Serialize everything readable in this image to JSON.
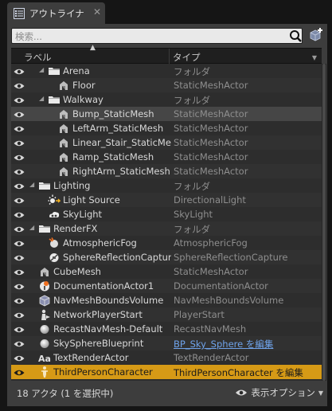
{
  "tab": {
    "title": "アウトライナ"
  },
  "search": {
    "placeholder": "検索..."
  },
  "columns": {
    "label": "ラベル",
    "type": "タイプ"
  },
  "rows": [
    {
      "depth": 3,
      "expanded": true,
      "icon": "folder-icon",
      "label": "Arena",
      "type": "フォルダ"
    },
    {
      "depth": 4,
      "icon": "static-mesh-icon",
      "label": "Floor",
      "type": "StaticMeshActor"
    },
    {
      "depth": 3,
      "expanded": true,
      "icon": "folder-icon",
      "label": "Walkway",
      "type": "フォルダ"
    },
    {
      "depth": 4,
      "icon": "static-mesh-icon",
      "label": "Bump_StaticMesh",
      "type": "StaticMeshActor",
      "highlight": true
    },
    {
      "depth": 4,
      "icon": "static-mesh-icon",
      "label": "LeftArm_StaticMesh",
      "type": "StaticMeshActor"
    },
    {
      "depth": 4,
      "icon": "static-mesh-icon",
      "label": "Linear_Stair_StaticMesh",
      "type": "StaticMeshActor"
    },
    {
      "depth": 4,
      "icon": "static-mesh-icon",
      "label": "Ramp_StaticMesh",
      "type": "StaticMeshActor"
    },
    {
      "depth": 4,
      "icon": "static-mesh-icon",
      "label": "RightArm_StaticMesh",
      "type": "StaticMeshActor"
    },
    {
      "depth": 2,
      "expanded": true,
      "icon": "folder-icon",
      "label": "Lighting",
      "type": "フォルダ"
    },
    {
      "depth": 3,
      "icon": "directional-light-icon",
      "label": "Light Source",
      "type": "DirectionalLight"
    },
    {
      "depth": 3,
      "icon": "sky-light-icon",
      "label": "SkyLight",
      "type": "SkyLight"
    },
    {
      "depth": 2,
      "expanded": true,
      "icon": "folder-icon",
      "label": "RenderFX",
      "type": "フォルダ"
    },
    {
      "depth": 3,
      "icon": "atmospheric-fog-icon",
      "label": "AtmosphericFog",
      "type": "AtmosphericFog"
    },
    {
      "depth": 3,
      "icon": "sphere-reflection-icon",
      "label": "SphereReflectionCapture",
      "type": "SphereReflectionCapture"
    },
    {
      "depth": 2,
      "icon": "static-mesh-icon",
      "label": "CubeMesh",
      "type": "StaticMeshActor"
    },
    {
      "depth": 2,
      "icon": "documentation-icon",
      "label": "DocumentationActor1",
      "type": "DocumentationActor"
    },
    {
      "depth": 2,
      "icon": "navmesh-bounds-icon",
      "label": "NavMeshBoundsVolume",
      "type": "NavMeshBoundsVolume"
    },
    {
      "depth": 2,
      "icon": "player-start-icon",
      "label": "NetworkPlayerStart",
      "type": "PlayerStart"
    },
    {
      "depth": 2,
      "icon": "sphere-icon",
      "label": "RecastNavMesh-Default",
      "type": "RecastNavMesh"
    },
    {
      "depth": 2,
      "icon": "sphere-icon",
      "label": "SkySphereBlueprint",
      "type": "BP_Sky_Sphere を編集",
      "link": true
    },
    {
      "depth": 2,
      "icon": "text-render-icon",
      "label": "TextRenderActor",
      "type": "TextRenderActor"
    },
    {
      "depth": 2,
      "icon": "character-icon",
      "label": "ThirdPersonCharacter",
      "type": "ThirdPersonCharacter を編集",
      "link": true,
      "selected": true
    }
  ],
  "footer": {
    "count": "18 アクタ (1 を選択中)",
    "view_options": "表示オプション"
  },
  "colors": {
    "selected": "#d69a16",
    "link": "#6fa3ea",
    "panel": "#3d3d3d"
  }
}
